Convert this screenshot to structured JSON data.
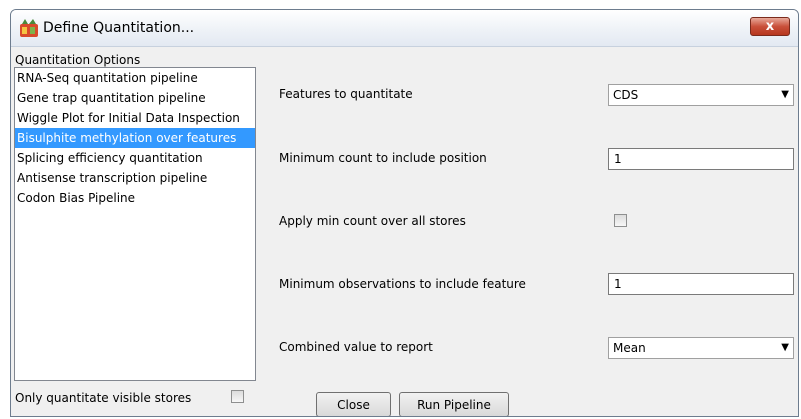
{
  "window": {
    "title": "Define Quantitation...",
    "close_glyph": "x"
  },
  "options": {
    "label": "Quantitation Options",
    "items": [
      {
        "label": "RNA-Seq quantitation pipeline",
        "selected": false
      },
      {
        "label": "Gene trap quantitation pipeline",
        "selected": false
      },
      {
        "label": "Wiggle Plot for Initial Data Inspection",
        "selected": false
      },
      {
        "label": "Bisulphite methylation over features",
        "selected": true
      },
      {
        "label": "Splicing efficiency quantitation",
        "selected": false
      },
      {
        "label": "Antisense transcription pipeline",
        "selected": false
      },
      {
        "label": "Codon Bias Pipeline",
        "selected": false
      }
    ],
    "visible_stores_label": "Only quantitate visible stores",
    "visible_stores_checked": false
  },
  "form": {
    "features_label": "Features to quantitate",
    "features_value": "CDS",
    "min_count_label": "Minimum count to include position",
    "min_count_value": "1",
    "apply_min_label": "Apply min count over all stores",
    "apply_min_checked": false,
    "min_obs_label": "Minimum observations to include feature",
    "min_obs_value": "1",
    "combined_label": "Combined value to report",
    "combined_value": "Mean"
  },
  "buttons": {
    "close_label": "Close",
    "run_label": "Run Pipeline"
  }
}
